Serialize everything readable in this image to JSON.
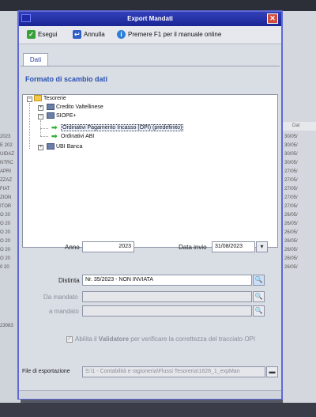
{
  "dialog": {
    "title": "Export Mandati",
    "close_glyph": "✕"
  },
  "toolbar": {
    "run_label": "Esegui",
    "cancel_label": "Annulla",
    "help_label": "Premere F1 per il manuale online"
  },
  "tabs": [
    {
      "label": "Dati"
    }
  ],
  "section_title": "Formato di scambio dati",
  "tree": {
    "root": "Tesorerie",
    "items": [
      {
        "label": "Credito Valtellinese",
        "icon": "book-icon"
      },
      {
        "label": "SIOPE+",
        "icon": "book-icon"
      },
      {
        "label": "Ordinativi Pagamento Incasso (OPI) (predefinito)",
        "icon": "arrow-icon",
        "selected": true
      },
      {
        "label": "Ordinativi ABI",
        "icon": "arrow-icon"
      },
      {
        "label": "UBI Banca",
        "icon": "book-icon"
      }
    ]
  },
  "form": {
    "anno_label": "Anno",
    "anno_value": "2023",
    "data_invio_label": "Data invio",
    "data_invio_value": "31/08/2023",
    "distinta_label": "Distinta",
    "distinta_value": "Nr. 35/2023 - NON INVIATA",
    "da_mandato_label": "Da mandato",
    "a_mandato_label": "a mandato",
    "validator_prefix": "Abilita il ",
    "validator_bold": "Validatore",
    "validator_suffix": " per verificare la correttezza del tracciato OPI",
    "file_label": "File di esportazione",
    "file_value": "S:\\1 - Contabilità e ragioneria\\Flussi Tesoreria\\1828_1_expMan"
  },
  "background": {
    "left_rows": [
      "2023",
      "E 202",
      "UIDAZ",
      "NTRC",
      "APRI",
      "ZZAZ",
      "FIAT",
      "ZION",
      "ITOR",
      "O 20",
      "O 20",
      "O 20",
      "O 20",
      "O 20",
      "O 20",
      "0 20"
    ],
    "left_footer": "23083",
    "right_header": "Dat",
    "right_rows": [
      "30/05/",
      "30/05/",
      "30/05/",
      "30/05/",
      "27/05/",
      "27/05/",
      "27/05/",
      "27/05/",
      "27/05/",
      "26/05/",
      "26/05/",
      "26/05/",
      "26/05/",
      "26/05/",
      "26/05/",
      "26/05/"
    ]
  },
  "colors": {
    "title_bar": "#1f2aa0",
    "dialog_border": "#5f69d6",
    "section_title": "#2a52b3",
    "selected_node": "#eaf0ff"
  }
}
